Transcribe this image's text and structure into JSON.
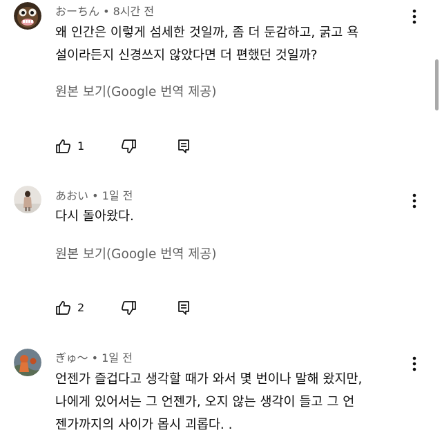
{
  "comments": [
    {
      "author": "おーちん",
      "time": "8시간 전",
      "separator": "•",
      "lines": [
        "왜 인간은 이렇게 섬세한 것일까, 좀 더 둔감하고, 굵고 욕",
        "설이라든지 신경쓰지 않았다면 더 편했던 것일까?"
      ],
      "translate_label": "원본 보기(Google 번역 제공)",
      "likes": "1"
    },
    {
      "author": "あおい",
      "time": "1일 전",
      "separator": "•",
      "lines": [
        "다시 돌아왔다."
      ],
      "translate_label": "원본 보기(Google 번역 제공)",
      "likes": "2"
    },
    {
      "author": "ぎゅ～",
      "time": "1일 전",
      "separator": "•",
      "lines": [
        "언젠가 즐겁다고 생각할 때가 와서 몇 번이나 말해 왔지만,",
        "나에게 있어서는 그 언젠가, 오지 않는 생각이 들고 그 언",
        "젠가까지의 사이가 몹시 괴롭다. ."
      ]
    }
  ],
  "icons": {
    "like": "thumbs-up-icon",
    "dislike": "thumbs-down-icon",
    "reply": "reply-icon",
    "more": "more-vert-icon"
  },
  "colors": {
    "text": "#0f0f0f",
    "secondary": "#606060",
    "scrollbar": "#a9a9a9"
  }
}
